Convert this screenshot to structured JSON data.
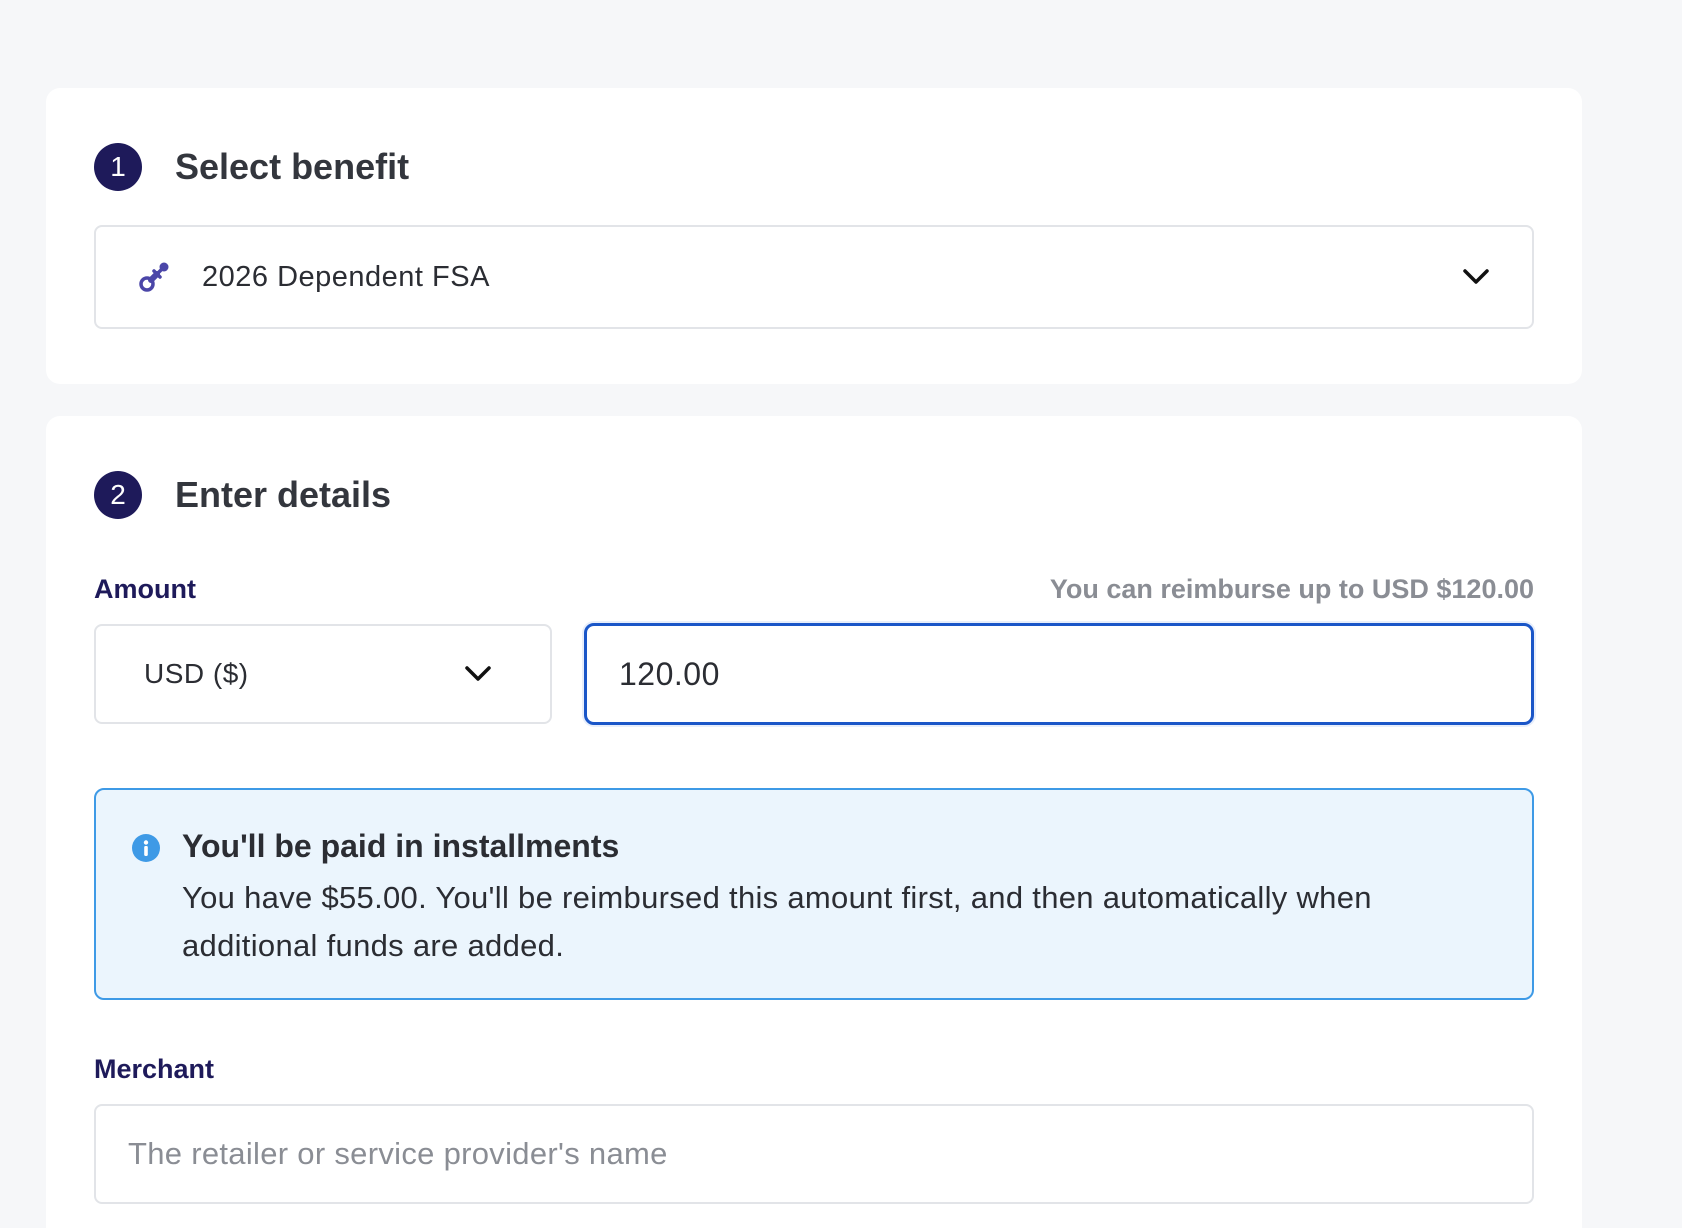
{
  "step1": {
    "number": "1",
    "title": "Select benefit",
    "benefit_icon": "pacifier-icon",
    "selected_benefit": "2026 Dependent FSA"
  },
  "step2": {
    "number": "2",
    "title": "Enter details",
    "amount": {
      "label": "Amount",
      "hint": "You can reimburse up to USD $120.00",
      "currency": "USD ($)",
      "value": "120.00"
    },
    "info": {
      "icon": "info-icon",
      "title": "You'll be paid in installments",
      "body": "You have $55.00. You'll be reimbursed this amount first, and then automatically when additional funds are added."
    },
    "merchant": {
      "label": "Merchant",
      "placeholder": "The retailer or service provider's name",
      "value": ""
    }
  },
  "colors": {
    "step_badge": "#1e1a5a",
    "label": "#1e1a5a",
    "focus_border": "#1a56c8",
    "info_border": "#3e9ae6",
    "info_bg": "#ebf5fd",
    "icon_purple": "#4b46a8"
  }
}
